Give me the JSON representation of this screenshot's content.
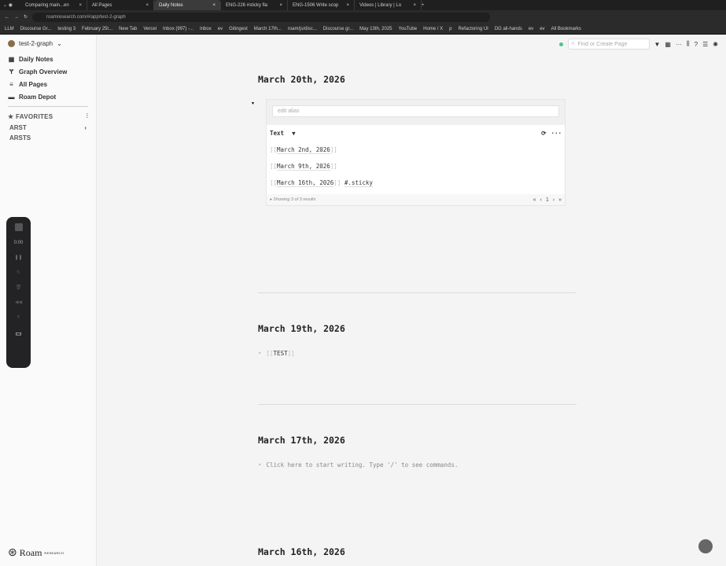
{
  "browser": {
    "tabs": [
      {
        "label": "Comparing main...en"
      },
      {
        "label": "All Pages"
      },
      {
        "label": "Daily Notes",
        "active": true
      },
      {
        "label": "ENG-226 #sticky fla"
      },
      {
        "label": "ENG-1506 Write scop"
      },
      {
        "label": "Videos | Library | Lo"
      }
    ],
    "url": "roamresearch.com/#/app/test-2-graph",
    "bookmarks": [
      "LLM",
      "Discourse Gr...",
      "testing 3",
      "February 25t...",
      "New Tab",
      "Vercel",
      "Inbox (997) -...",
      "Inbox",
      "ev",
      "Gitingest",
      "March 17th...",
      "roam/js/disc...",
      "Discourse gr...",
      "May 13th, 2025",
      "YouTube",
      "Home / X",
      "p",
      "Refactoring UI",
      "DG all-hands",
      "ev",
      "ev",
      "All Bookmarks"
    ]
  },
  "sidebar": {
    "graph_name": "test-2-graph",
    "nav": [
      {
        "label": "Daily Notes",
        "icon": "calendar-icon"
      },
      {
        "label": "Graph Overview",
        "icon": "graph-icon"
      },
      {
        "label": "All Pages",
        "icon": "list-icon"
      },
      {
        "label": "Roam Depot",
        "icon": "store-icon"
      }
    ],
    "favorites_label": "FAVORITES",
    "shortcuts": [
      "ARST",
      "ARSTS"
    ],
    "logo": "Roam",
    "logo_sub": "RESEARCH"
  },
  "topbar": {
    "search_placeholder": "Find or Create Page",
    "status_color": "#4cc38a"
  },
  "recorder": {
    "time": "0:00"
  },
  "pages": [
    {
      "title": "March 20th, 2026",
      "query": {
        "alias_placeholder": "edit alias",
        "column": "Text",
        "results": [
          {
            "ref": "March 2nd, 2026",
            "tag": ""
          },
          {
            "ref": "March 9th, 2026",
            "tag": ""
          },
          {
            "ref": "March 16th, 2026",
            "tag": "#.sticky"
          }
        ],
        "footer": "Showing 3 of 3 results",
        "page": "1"
      }
    },
    {
      "title": "March 19th, 2026",
      "blocks": [
        {
          "ref": "TEST"
        }
      ]
    },
    {
      "title": "March 17th, 2026",
      "placeholder": "Click here to start writing. Type '/' to see commands."
    },
    {
      "title": "March 16th, 2026"
    }
  ]
}
